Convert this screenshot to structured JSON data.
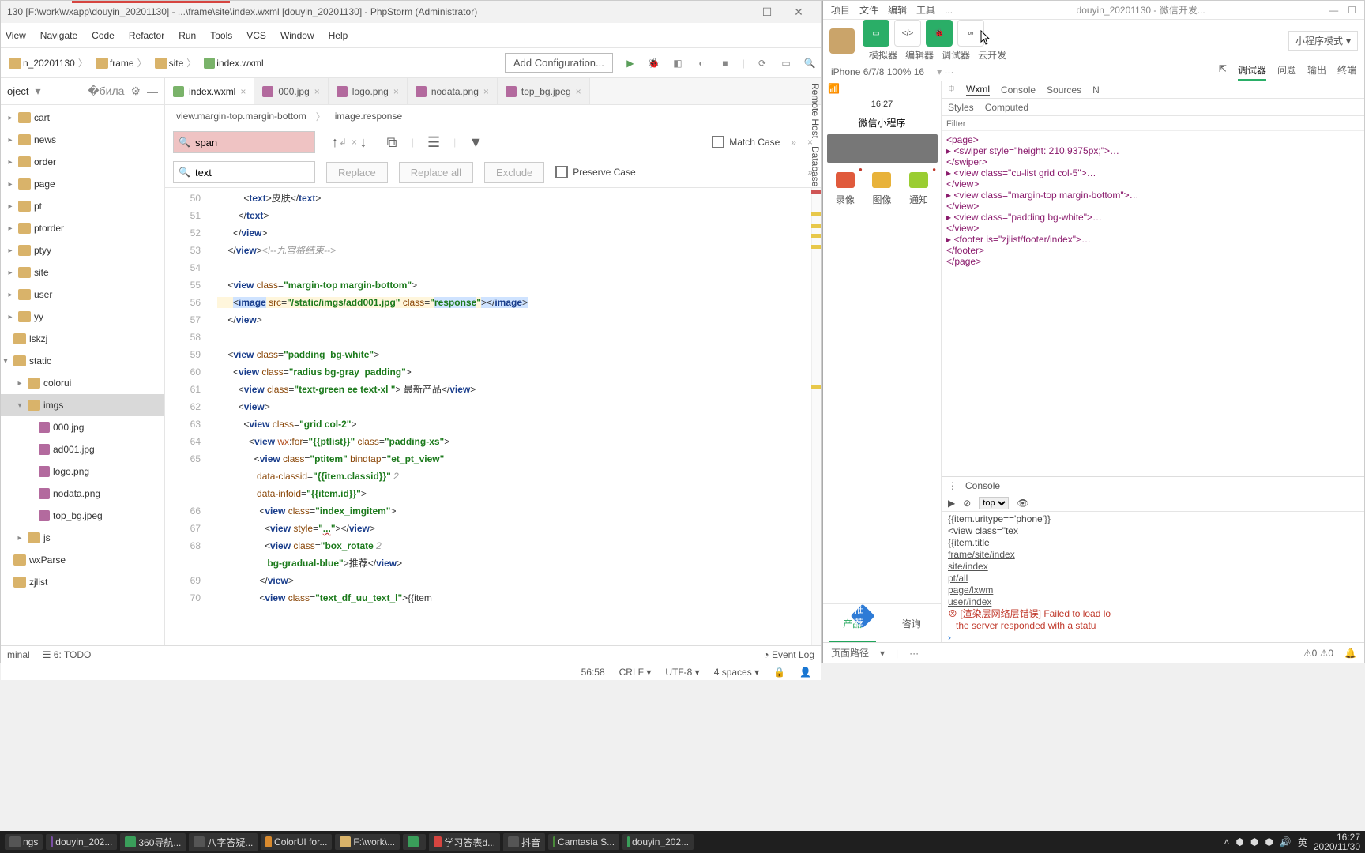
{
  "phpstorm": {
    "title": "130 [F:\\work\\wxapp\\douyin_20201130] - ...\\frame\\site\\index.wxml [douyin_20201130] - PhpStorm (Administrator)",
    "menu": [
      "View",
      "Navigate",
      "Code",
      "Refactor",
      "Run",
      "Tools",
      "VCS",
      "Window",
      "Help"
    ],
    "breadcrumbs": [
      "n_20201130",
      "frame",
      "site",
      "index.wxml"
    ],
    "addConfig": "Add Configuration...",
    "projectTitle": "oject",
    "tree": {
      "folders": [
        "cart",
        "news",
        "order",
        "page",
        "pt",
        "ptorder",
        "ptyy",
        "site",
        "user",
        "yy"
      ],
      "lskzj": "lskzj",
      "static": "static",
      "colorui": "colorui",
      "imgs": "imgs",
      "imgFiles": [
        "000.jpg",
        "ad001.jpg",
        "logo.png",
        "nodata.png",
        "top_bg.jpeg"
      ],
      "js": "js",
      "wxParse": "wxParse",
      "zjlist": "zjlist"
    },
    "tabs": [
      {
        "label": "index.wxml",
        "active": true,
        "type": "code"
      },
      {
        "label": "000.jpg",
        "active": false,
        "type": "img"
      },
      {
        "label": "logo.png",
        "active": false,
        "type": "img"
      },
      {
        "label": "nodata.png",
        "active": false,
        "type": "img"
      },
      {
        "label": "top_bg.jpeg",
        "active": false,
        "type": "img"
      }
    ],
    "bc2": [
      "view.margin-top.margin-bottom",
      "image.response"
    ],
    "find": {
      "value": "span"
    },
    "replace": {
      "value": "text"
    },
    "findButtons": {
      "replace": "Replace",
      "replaceAll": "Replace all",
      "exclude": "Exclude"
    },
    "checks": {
      "matchCase": "Match Case",
      "preserveCase": "Preserve Case"
    },
    "gutterStart": 50,
    "status": {
      "left": [
        "minal",
        "6: TODO"
      ],
      "right": [
        "Event Log"
      ],
      "bottom": [
        "56:58",
        "CRLF",
        "UTF-8",
        "4 spaces"
      ]
    },
    "rightTools": [
      "Remote Host",
      "Database"
    ]
  },
  "wx": {
    "menus": [
      "项目",
      "文件",
      "编辑",
      "工具",
      "..."
    ],
    "projName": "douyin_20201130",
    "devtools": "- 微信开发...",
    "toolbarLabels": [
      "模拟器",
      "编辑器",
      "调试器",
      "云开发"
    ],
    "mode": "小程序模式",
    "device": "iPhone 6/7/8 100% 16",
    "devtabs": [
      "调试器",
      "问题",
      "输出",
      "终端"
    ],
    "phone": {
      "time": "16:27",
      "title": "微信小程序",
      "icons": [
        {
          "label": "录像",
          "color": "#e05a3c"
        },
        {
          "label": "图像",
          "color": "#e8b23a"
        },
        {
          "label": "通知",
          "color": "#9acd32"
        }
      ],
      "bottomTabs": [
        {
          "label": "产品",
          "active": true,
          "badge": "推荐"
        },
        {
          "label": "咨询",
          "active": false
        }
      ]
    },
    "inspector": {
      "tabs": [
        "Wxml",
        "Console",
        "Sources",
        "N"
      ],
      "subtabs": [
        "Styles",
        "Computed"
      ],
      "filterPlaceholder": "Filter",
      "dom": [
        "<page>",
        " ▸ <swiper style=\"height: 210.9375px;\">…",
        "  </swiper>",
        " ▸ <view class=\"cu-list grid col-5\">…",
        "  </view>",
        " ▸ <view class=\"margin-top margin-bottom\">…",
        "  </view>",
        " ▸ <view class=\"padding bg-white\">…",
        "  </view>",
        " ▸ <footer is=\"zjlist/footer/index\">…",
        "  </footer>",
        " </page>"
      ]
    },
    "console": {
      "title": "Console",
      "scope": "top",
      "lines": [
        "{{item.uritype=='phone'}}",
        "        <view class=\"tex",
        "          {{item.title",
        "frame/site/index",
        "site/index",
        "pt/all",
        "page/lxwm",
        "user/index"
      ],
      "error": "[渲染层网络层错误] Failed to load lo",
      "error2": "the server responded with a statu"
    },
    "status": {
      "path": "页面路径",
      "warn": "⚠0 ⚠0"
    }
  },
  "taskbar": {
    "items": [
      "ngs",
      "douyin_202...",
      "360导航...",
      "八字答疑...",
      "ColorUI for...",
      "F:\\work\\...",
      "",
      "学习答表d...",
      "抖音",
      "Camtasia S...",
      "douyin_202..."
    ],
    "clock": {
      "time": "16:27",
      "date": "2020/11/30"
    }
  }
}
